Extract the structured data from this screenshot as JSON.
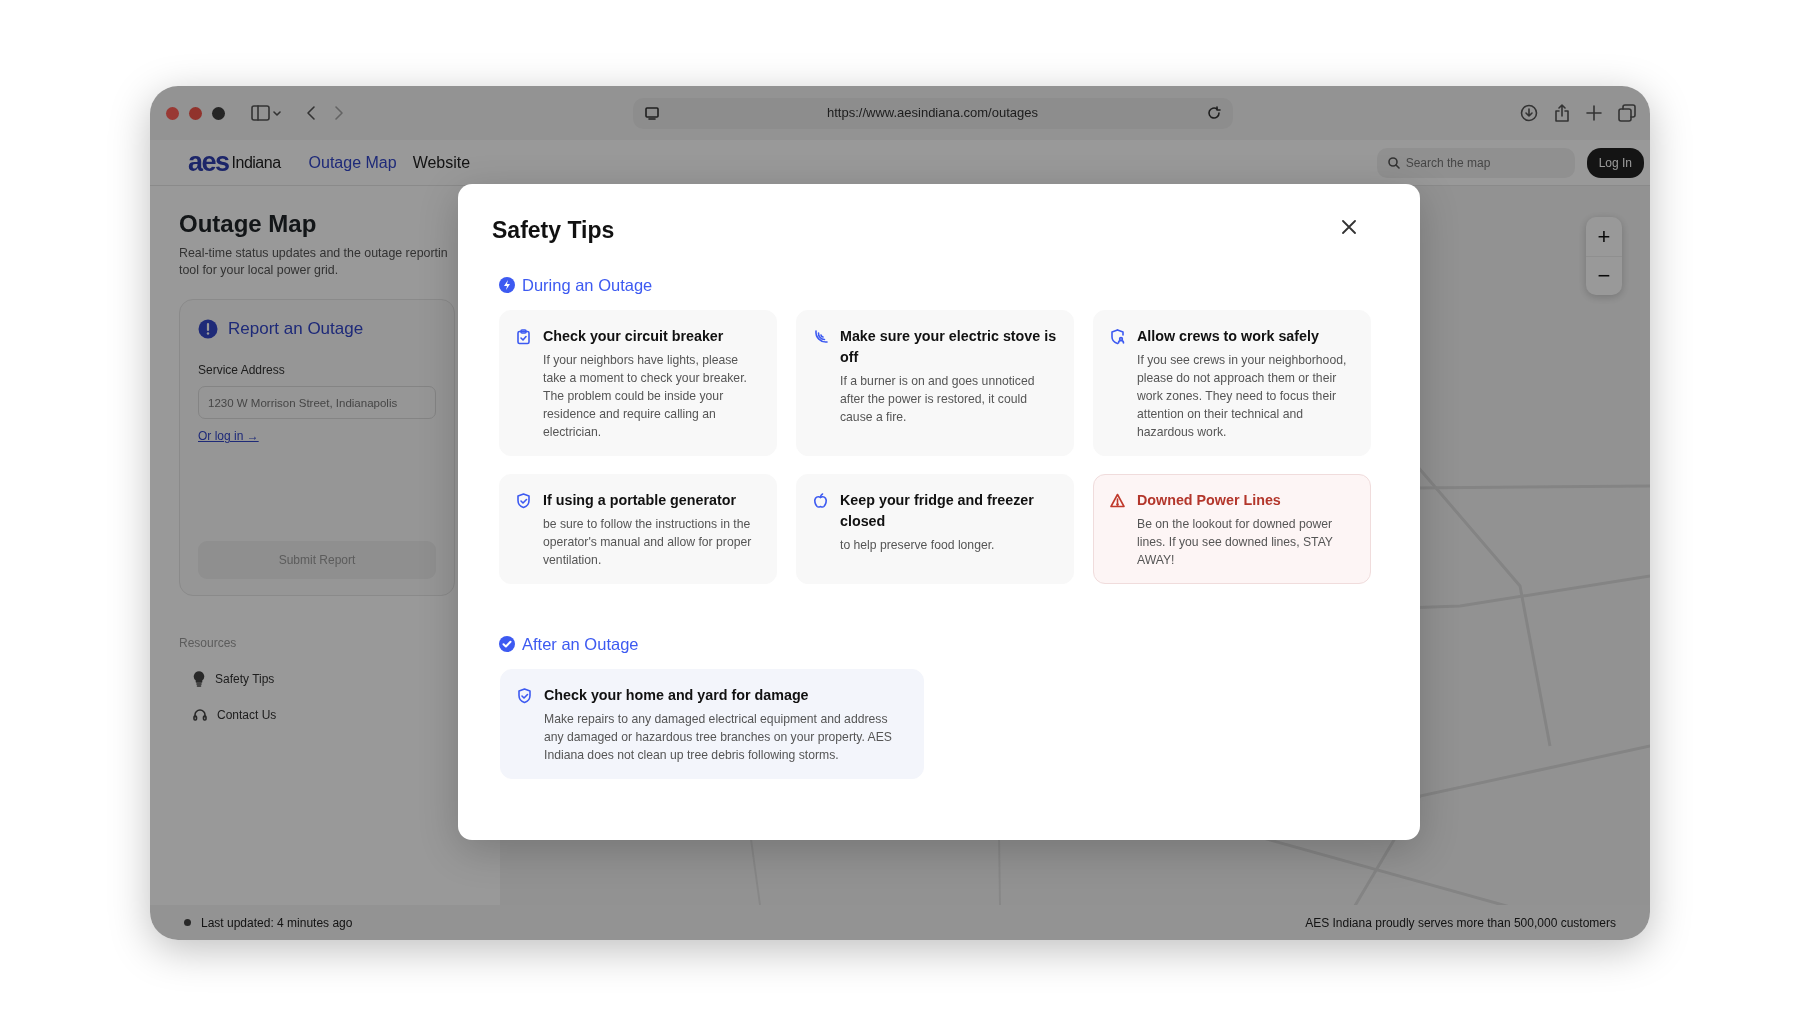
{
  "browser": {
    "url": "https://www.aesindiana.com/outages"
  },
  "nav": {
    "logo_mark": "aes",
    "logo_text": "Indiana",
    "links": [
      {
        "label": "Outage Map",
        "selected": true
      },
      {
        "label": "Website",
        "selected": false
      }
    ],
    "search": {
      "placeholder": "Search the map"
    },
    "login": "Log In"
  },
  "sidebar": {
    "title": "Outage Map",
    "subtitle_lines": [
      "Real-time status updates and the outage reportin",
      "tool for your local power grid."
    ],
    "report": {
      "title": "Report an Outage",
      "field_label": "Service Address",
      "placeholder": "1230 W Morrison Street, Indianapolis",
      "login_link": "Or log in →",
      "submit": {
        "label": "Submit Report",
        "disabled": true
      }
    },
    "resources": {
      "heading": "Resources",
      "items": [
        {
          "label": "Safety Tips"
        },
        {
          "label": "Contact Us"
        }
      ]
    }
  },
  "map": {
    "zoom_controls": [
      "+",
      "−"
    ]
  },
  "status_bar": {
    "left": "Last updated: 4 minutes ago",
    "right": "AES Indiana proudly serves more than 500,000 customers"
  },
  "modal": {
    "title": "Safety Tips",
    "sections": [
      {
        "heading": "During an Outage",
        "tips": [
          {
            "kind": "tip",
            "title": "Check your circuit breaker",
            "body": "If your neighbors have lights, please take a moment to check your breaker. The problem could be inside your residence and require calling an electrician."
          },
          {
            "kind": "tip",
            "title": "Make sure your electric stove is off",
            "body": "If a burner is on and goes unnoticed after the power is restored, it could cause a fire."
          },
          {
            "kind": "tip",
            "title": "Allow crews to work safely",
            "body": "If you see crews in your neighborhood, please do not approach them or their work zones. They need to focus their attention on their technical and hazardous work."
          },
          {
            "kind": "tip",
            "title": "If using a portable generator",
            "body": "be sure to follow the instructions in the operator's manual and allow for proper ventilation."
          },
          {
            "kind": "tip",
            "title": "Keep your fridge and freezer closed",
            "body": "to help preserve food longer."
          },
          {
            "kind": "warning",
            "title": "Downed Power Lines",
            "body": "Be on the lookout for downed power lines. If you see downed lines, STAY AWAY!"
          }
        ]
      },
      {
        "heading": "After an Outage",
        "tips": [
          {
            "kind": "info",
            "title": "Check your home and yard for damage",
            "body": "Make repairs to any damaged electrical equipment and address any damaged or hazardous tree branches on your property. AES Indiana does not clean up tree debris following storms."
          }
        ]
      }
    ]
  }
}
